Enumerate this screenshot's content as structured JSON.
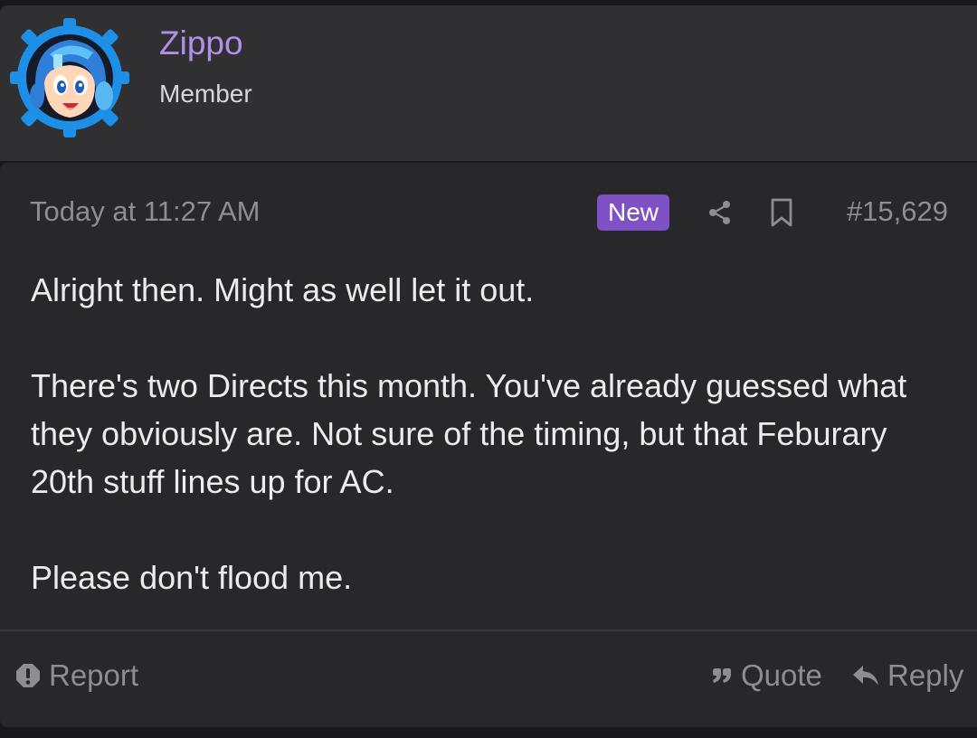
{
  "colors": {
    "username": "#b28fe8",
    "badge": "#7e52c5"
  },
  "user": {
    "name": "Zippo",
    "title": "Member",
    "avatar_icon": "megaman-avatar-icon"
  },
  "post": {
    "timestamp": "Today at 11:27 AM",
    "badge": "New",
    "number": "#15,629",
    "paragraphs": [
      "Alright then. Might as well let it out.",
      "There's two Directs this month. You've already guessed what they obviously are. Not sure of the timing, but that Feburary 20th stuff lines up for AC.",
      "Please don't flood me."
    ]
  },
  "actions": {
    "report": "Report",
    "quote": "Quote",
    "reply": "Reply"
  }
}
